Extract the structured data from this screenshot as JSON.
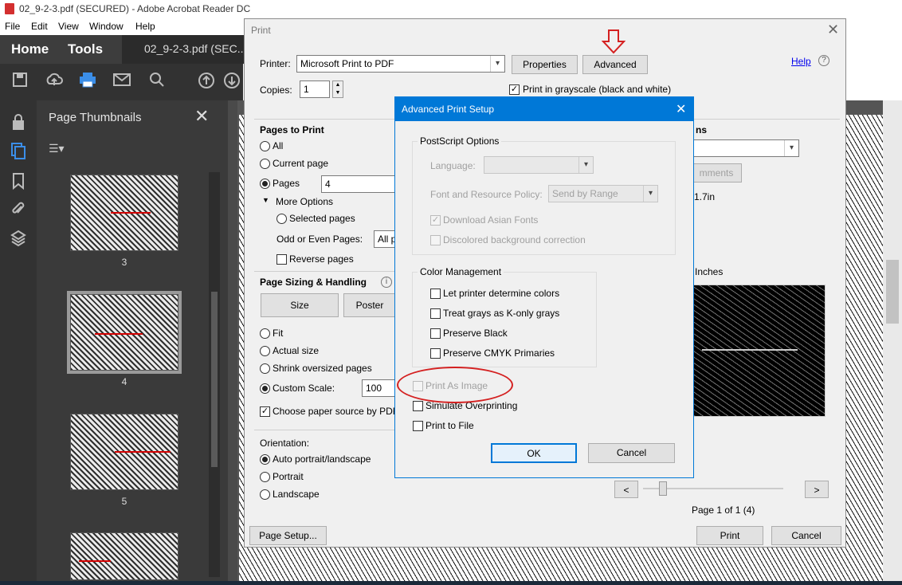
{
  "app": {
    "title": "02_9-2-3.pdf (SECURED) - Adobe Acrobat Reader DC",
    "menu": [
      "File",
      "Edit",
      "View",
      "Window",
      "Help"
    ],
    "nav_home": "Home",
    "nav_tools": "Tools",
    "doc_tab": "02_9-2-3.pdf (SEC..."
  },
  "thumbnails": {
    "title": "Page Thumbnails",
    "pages": [
      "3",
      "4",
      "5"
    ]
  },
  "print": {
    "title": "Print",
    "printer_label": "Printer:",
    "printer_value": "Microsoft Print to PDF",
    "properties_btn": "Properties",
    "advanced_btn": "Advanced",
    "help_link": "Help",
    "copies_label": "Copies:",
    "copies_value": "1",
    "grayscale_label": "Print in grayscale (black and white)",
    "pages_to_print": {
      "header": "Pages to Print",
      "all": "All",
      "current": "Current page",
      "pages": "Pages",
      "pages_value": "4",
      "more_options": "More Options",
      "selected_pages": "Selected pages",
      "odd_even_label": "Odd or Even Pages:",
      "odd_even_value": "All p",
      "reverse": "Reverse pages"
    },
    "sizing": {
      "header": "Page Sizing & Handling",
      "size_btn": "Size",
      "poster_btn": "Poster",
      "fit": "Fit",
      "actual": "Actual size",
      "shrink": "Shrink oversized pages",
      "custom": "Custom Scale:",
      "custom_value": "100",
      "paper_source": "Choose paper source by PDF"
    },
    "orientation": {
      "header": "Orientation:",
      "auto": "Auto portrait/landscape",
      "portrait": "Portrait",
      "landscape": "Landscape"
    },
    "right": {
      "comments_header_partial": "ns",
      "comments_btn_partial": "mments",
      "size_partial": "1.7in",
      "units_partial": "Inches",
      "page_counter": "Page 1 of 1 (4)",
      "prev": "<",
      "next": ">"
    },
    "page_setup_btn": "Page Setup...",
    "print_btn": "Print",
    "cancel_btn": "Cancel"
  },
  "advanced": {
    "title": "Advanced Print Setup",
    "postscript": {
      "header": "PostScript Options",
      "language_label": "Language:",
      "language_value": "",
      "font_policy_label": "Font and Resource Policy:",
      "font_policy_value": "Send by Range",
      "download_asian": "Download Asian Fonts",
      "discolored": "Discolored background correction"
    },
    "color": {
      "header": "Color Management",
      "let_printer": "Let printer determine colors",
      "treat_grays": "Treat grays as K-only grays",
      "preserve_black": "Preserve Black",
      "preserve_cmyk": "Preserve CMYK Primaries"
    },
    "print_as_image": "Print As Image",
    "simulate_overprinting": "Simulate Overprinting",
    "print_to_file": "Print to File",
    "ok_btn": "OK",
    "cancel_btn": "Cancel"
  },
  "colors": {
    "accent_blue": "#0078d7",
    "annotation_red": "#d42020",
    "dark_panel": "#3a3a3a"
  }
}
